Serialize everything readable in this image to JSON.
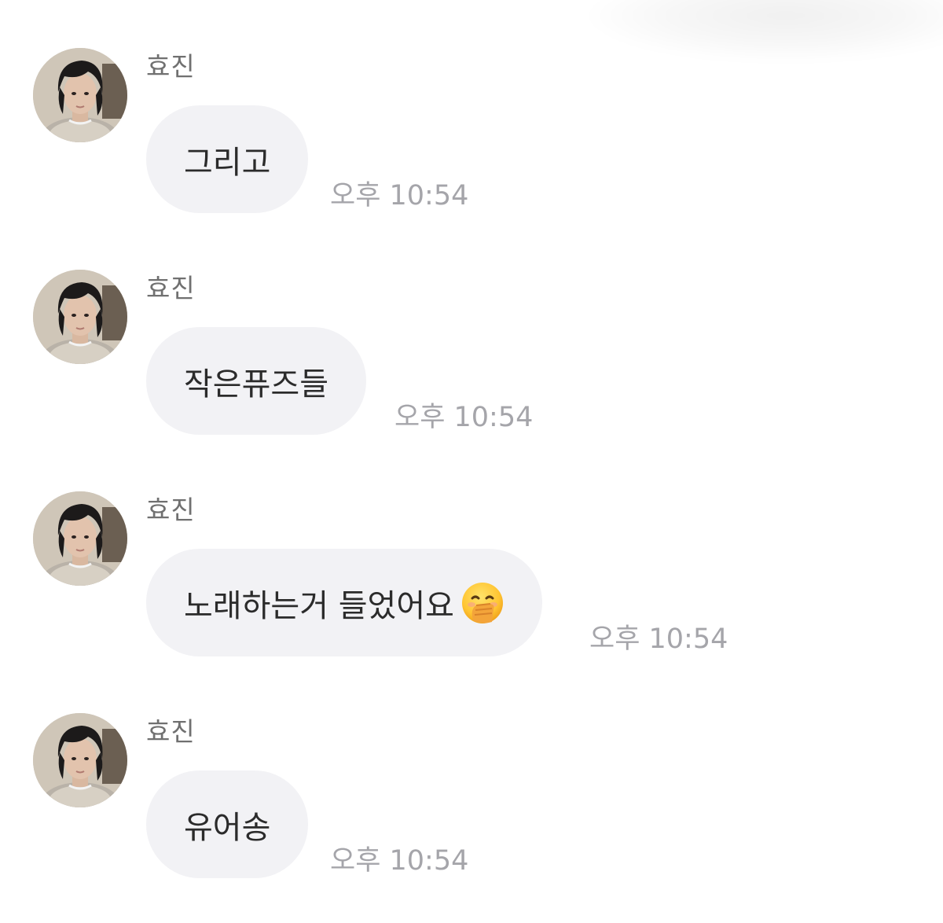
{
  "chat": {
    "messages": [
      {
        "sender": "효진",
        "text": "그리고",
        "time": "오후 10:54",
        "emoji": ""
      },
      {
        "sender": "효진",
        "text": "작은퓨즈들",
        "time": "오후 10:54",
        "emoji": ""
      },
      {
        "sender": "효진",
        "text": "노래하는거 들었어요",
        "time": "오후 10:54",
        "emoji": "hand-over-mouth-emoji"
      },
      {
        "sender": "효진",
        "text": "유어송",
        "time": "오후 10:54",
        "emoji": ""
      }
    ]
  },
  "colors": {
    "bubble": "#f2f2f5",
    "sender": "#707070",
    "timestamp": "#a5a5aa",
    "text": "#2b2b2b"
  }
}
